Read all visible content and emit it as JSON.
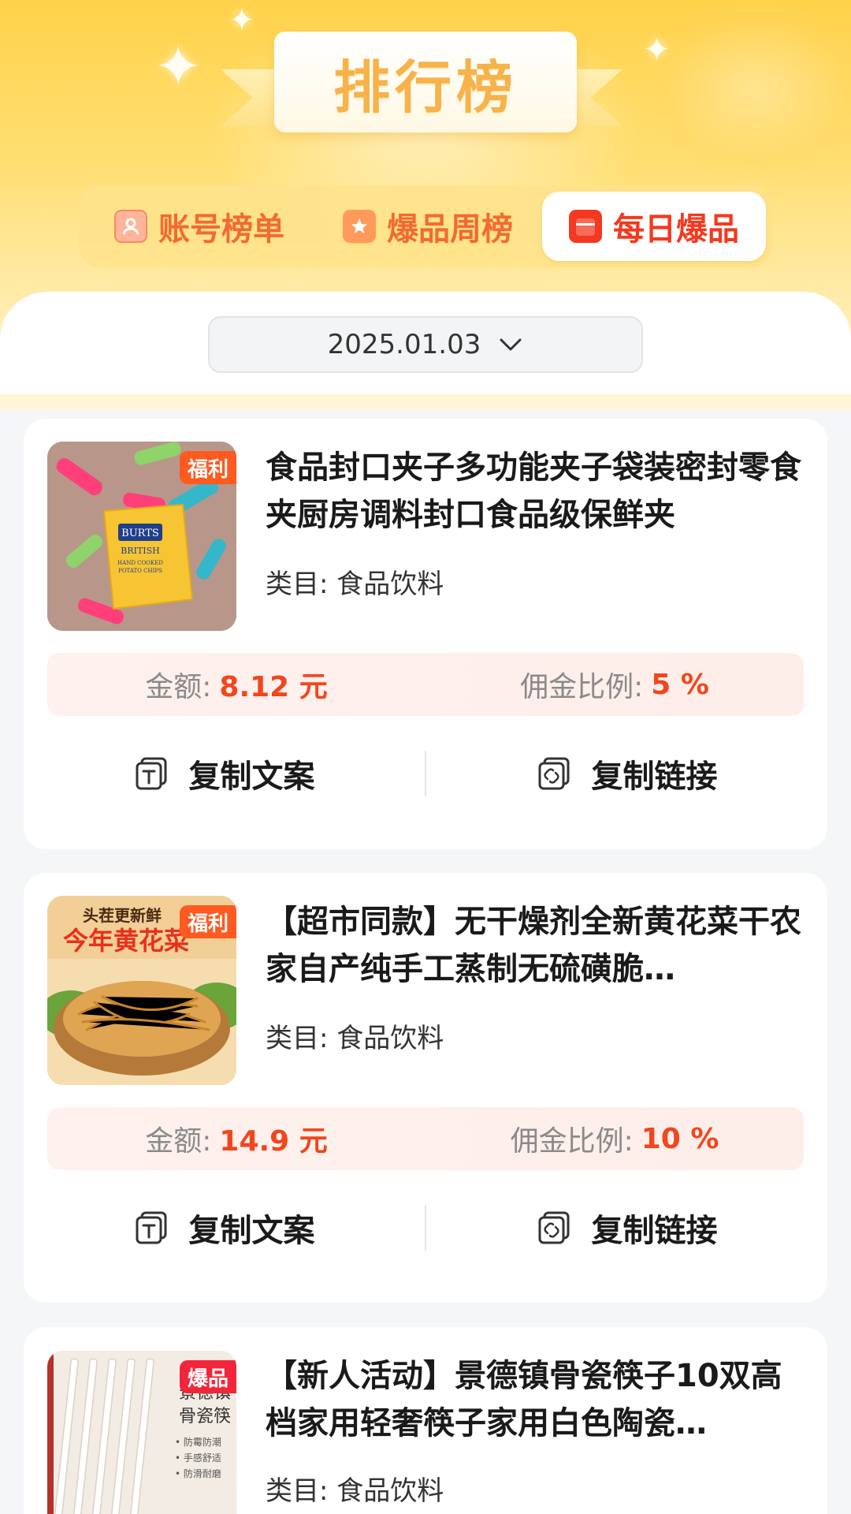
{
  "header": {
    "title": "排行榜",
    "tabs": [
      {
        "label": "账号榜单",
        "icon": "user-icon",
        "active": false
      },
      {
        "label": "爆品周榜",
        "icon": "star-icon",
        "active": false
      },
      {
        "label": "每日爆品",
        "icon": "calendar-icon",
        "active": true
      }
    ]
  },
  "date_filter": {
    "value": "2025.01.03",
    "icon": "chevron-down-icon"
  },
  "products": [
    {
      "title": "食品封口夹子多功能夹子袋装密封零食夹厨房调料封口食品级保鲜夹",
      "badge": "福利",
      "category": "类目: 食品饮料",
      "amount_label": "金额:",
      "amount_value": "8.12 元",
      "commission_label": "佣金比例:",
      "commission_value": "5 %",
      "copy_text_label": "复制文案",
      "copy_link_label": "复制链接",
      "image_text": [
        "BURTS",
        "BRITISH",
        "HAND COOKED",
        "POTATO CHIPS"
      ]
    },
    {
      "title": "【超市同款】无干燥剂全新黄花菜干农家自产纯手工蒸制无硫磺脆…",
      "badge": "福利",
      "category": "类目: 食品饮料",
      "amount_label": "金额:",
      "amount_value": "14.9 元",
      "commission_label": "佣金比例:",
      "commission_value": "10 %",
      "copy_text_label": "复制文案",
      "copy_link_label": "复制链接",
      "image_text": [
        "头茬更新鲜",
        "今年黄花菜"
      ]
    },
    {
      "title": "【新人活动】景德镇骨瓷筷子10双高档家用轻奢筷子家用白色陶瓷…",
      "badge": "爆品",
      "category": "类目: 食品饮料",
      "image_text": [
        "景德镇",
        "骨瓷筷",
        "• 防霉防潮",
        "• 手感舒适",
        "• 防滑耐磨"
      ]
    }
  ],
  "colors": {
    "accent": "#f2461d",
    "tab_text": "#f26b32",
    "header_yellow": "#ffd24a"
  }
}
